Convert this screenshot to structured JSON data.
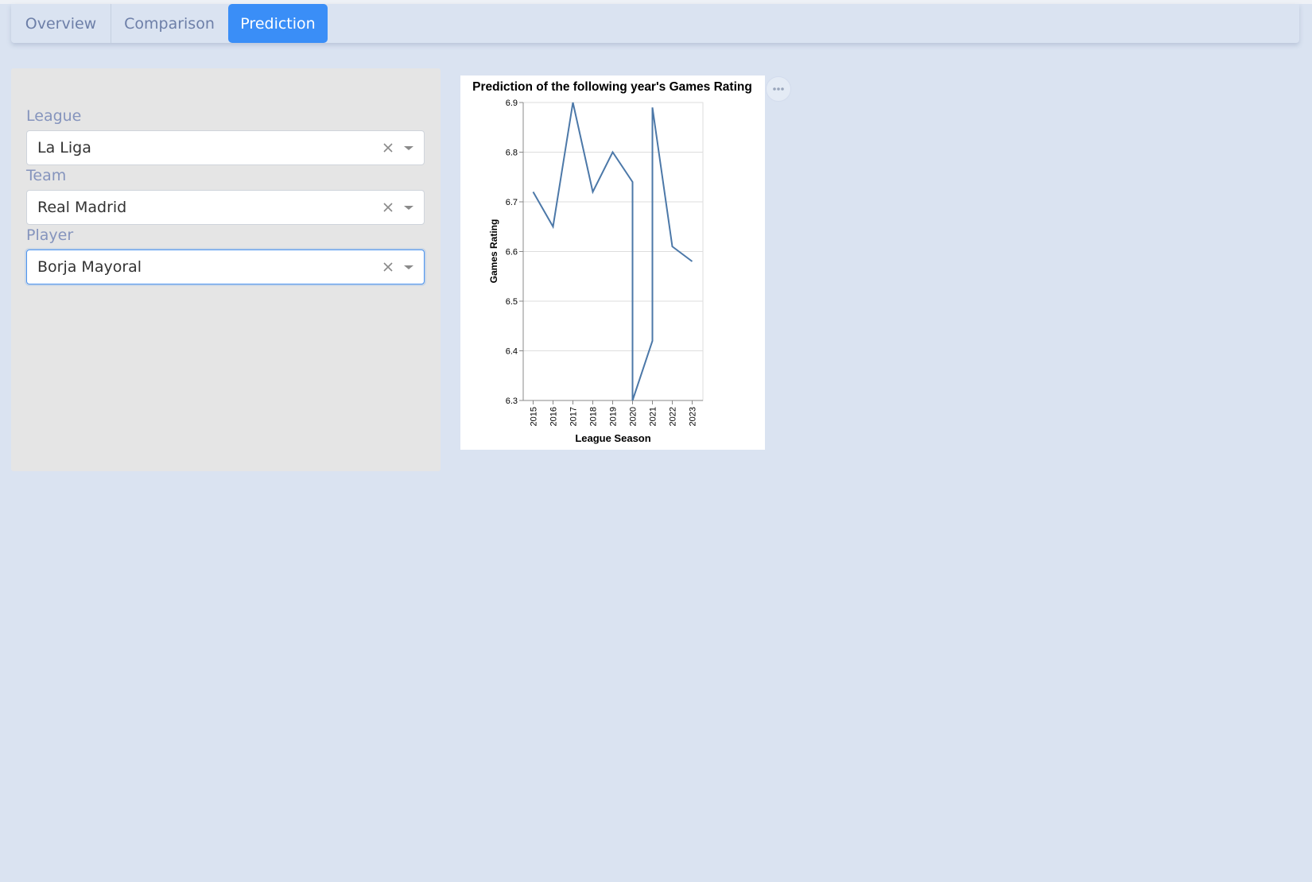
{
  "tabs": [
    {
      "label": "Overview",
      "active": false
    },
    {
      "label": "Comparison",
      "active": false
    },
    {
      "label": "Prediction",
      "active": true
    }
  ],
  "filters": {
    "league": {
      "label": "League",
      "value": "La Liga"
    },
    "team": {
      "label": "Team",
      "value": "Real Madrid"
    },
    "player": {
      "label": "Player",
      "value": "Borja Mayoral"
    }
  },
  "icons": {
    "clear": "close-icon",
    "dropdown": "chevron-down-icon",
    "actions": "more-horizontal-icon"
  },
  "colors": {
    "background": "#dae3f1",
    "active_tab": "#3a8ef7",
    "line": "#4c78a8",
    "label": "#8594bd"
  },
  "chart_data": {
    "type": "line",
    "title": "Prediction of the following year's Games Rating",
    "xlabel": "League Season",
    "ylabel": "Games Rating",
    "ylim": [
      6.3,
      6.9
    ],
    "yticks": [
      6.3,
      6.4,
      6.5,
      6.6,
      6.7,
      6.8,
      6.9
    ],
    "grid": true,
    "categories": [
      "2015",
      "2016",
      "2017",
      "2018",
      "2019",
      "2020",
      "2021",
      "2022",
      "2023"
    ],
    "points": [
      {
        "x": "2015",
        "y": 6.72
      },
      {
        "x": "2016",
        "y": 6.65
      },
      {
        "x": "2017",
        "y": 6.9
      },
      {
        "x": "2018",
        "y": 6.72
      },
      {
        "x": "2019",
        "y": 6.8
      },
      {
        "x": "2020",
        "y": 6.74
      },
      {
        "x": "2020",
        "y": 6.3
      },
      {
        "x": "2021",
        "y": 6.42
      },
      {
        "x": "2021",
        "y": 6.89
      },
      {
        "x": "2022",
        "y": 6.61
      },
      {
        "x": "2023",
        "y": 6.58
      }
    ]
  }
}
